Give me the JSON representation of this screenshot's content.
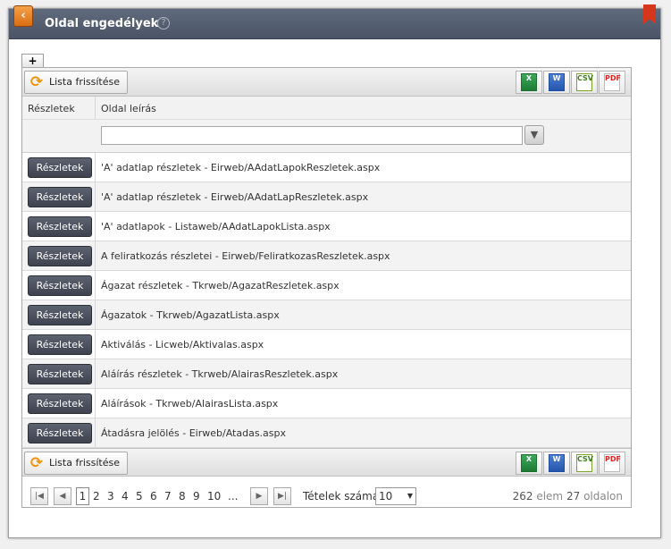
{
  "window": {
    "title": "Oldal engedélyek"
  },
  "toolbar": {
    "add_tab": "+",
    "refresh_label": "Lista frissítése"
  },
  "exports": {
    "xls": "X",
    "doc": "W",
    "csv": "CSV",
    "pdf": "PDF"
  },
  "columns": {
    "details": "Részletek",
    "description": "Oldal leírás"
  },
  "filter": {
    "value": "",
    "icon": "filter-icon"
  },
  "rows": [
    {
      "button": "Részletek",
      "desc": "'A' adatlap részletek - Eirweb/AAdatLapokReszletek.aspx"
    },
    {
      "button": "Részletek",
      "desc": "'A' adatlap részletek - Eirweb/AAdatLapReszletek.aspx"
    },
    {
      "button": "Részletek",
      "desc": "'A' adatlapok - Listaweb/AAdatLapokLista.aspx"
    },
    {
      "button": "Részletek",
      "desc": "A feliratkozás részletei - Eirweb/FeliratkozasReszletek.aspx"
    },
    {
      "button": "Részletek",
      "desc": "Ágazat részletek - Tkrweb/AgazatReszletek.aspx"
    },
    {
      "button": "Részletek",
      "desc": "Ágazatok - Tkrweb/AgazatLista.aspx"
    },
    {
      "button": "Részletek",
      "desc": "Aktiválás - Licweb/Aktivalas.aspx"
    },
    {
      "button": "Részletek",
      "desc": "Aláírás részletek - Tkrweb/AlairasReszletek.aspx"
    },
    {
      "button": "Részletek",
      "desc": "Aláírások - Tkrweb/AlairasLista.aspx"
    },
    {
      "button": "Részletek",
      "desc": "Átadásra jelölés - Eirweb/Atadas.aspx"
    }
  ],
  "pager": {
    "pages": [
      "1",
      "2",
      "3",
      "4",
      "5",
      "6",
      "7",
      "8",
      "9",
      "10",
      "..."
    ],
    "current": "1",
    "page_size_label": "Tételek száma:",
    "page_size": "10",
    "total_items": "262",
    "items_word": "elem",
    "total_pages": "27",
    "pages_word": "oldalon"
  },
  "colors": {
    "titlebar": "#4f5a6c",
    "accent": "#f0930e",
    "bookmark": "#d6361c"
  }
}
